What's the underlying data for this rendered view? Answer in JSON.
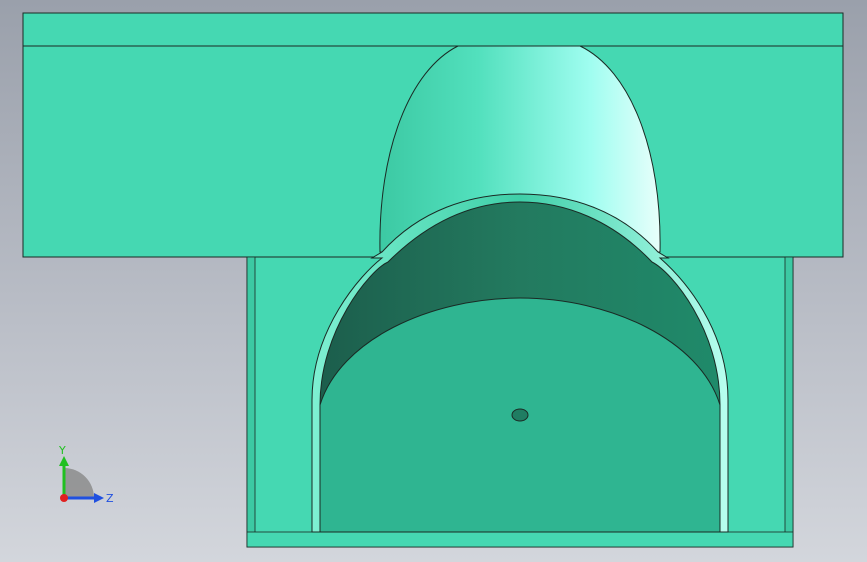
{
  "viewport": {
    "model_colors": {
      "face": "#45d8b2",
      "face_dark": "#2fb591",
      "inner_wall": "#207a5e",
      "edge": "#1a2a24",
      "highlight": "#9ffdf0"
    }
  },
  "triad": {
    "y_label": "Y",
    "z_label": "Z",
    "y_color": "#20c020",
    "z_color": "#2050e0",
    "x_color": "#e02020"
  }
}
